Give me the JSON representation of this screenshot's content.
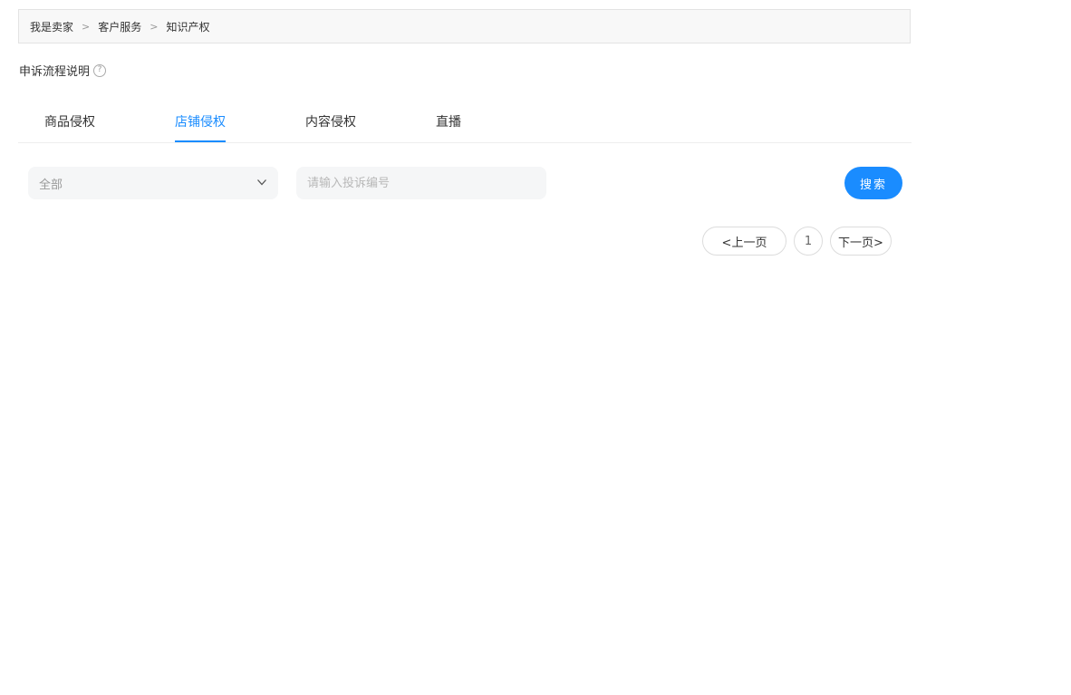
{
  "breadcrumb": {
    "items": [
      "我是卖家",
      "客户服务",
      "知识产权"
    ],
    "separator": ">"
  },
  "appeal": {
    "label": "申诉流程说明",
    "help_icon": "?"
  },
  "tabs": [
    {
      "label": "商品侵权",
      "active": false
    },
    {
      "label": "店铺侵权",
      "active": true
    },
    {
      "label": "内容侵权",
      "active": false
    },
    {
      "label": "直播",
      "active": false
    }
  ],
  "filter": {
    "select_value": "全部",
    "search_placeholder": "请输入投诉编号",
    "search_label": "搜索"
  },
  "pagination": {
    "prev_label": "<上一页",
    "current_page": "1",
    "next_label": "下一页>"
  },
  "colors": {
    "accent": "#1a8cff",
    "input_bg": "#f5f6f7",
    "breadcrumb_bg": "#f8f8f8"
  }
}
